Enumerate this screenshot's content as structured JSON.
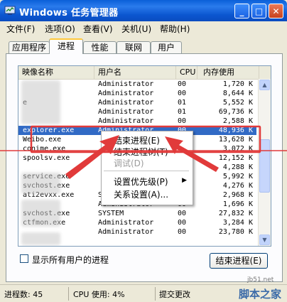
{
  "title": "Windows 任务管理器",
  "menu": [
    "文件(F)",
    "选项(O)",
    "查看(V)",
    "关机(U)",
    "帮助(H)"
  ],
  "tabs": [
    "应用程序",
    "进程",
    "性能",
    "联网",
    "用户"
  ],
  "active_tab": "进程",
  "columns": [
    "映像名称",
    "用户名",
    "CPU",
    "内存使用"
  ],
  "rows": [
    {
      "name": "",
      "user": "Administrator",
      "cpu": "00",
      "mem": "1,720 K"
    },
    {
      "name": "",
      "user": "Administrator",
      "cpu": "00",
      "mem": "8,644 K"
    },
    {
      "name": "e",
      "user": "Administrator",
      "cpu": "01",
      "mem": "5,552 K"
    },
    {
      "name": "",
      "user": "Administrator",
      "cpu": "01",
      "mem": "69,736 K"
    },
    {
      "name": "",
      "user": "Administrator",
      "cpu": "00",
      "mem": "2,588 K"
    },
    {
      "name": "explorer.exe",
      "user": "Administrator",
      "cpu": "00",
      "mem": "48,936 K",
      "selected": true
    },
    {
      "name": "Weibo.exe",
      "user": "",
      "cpu": "",
      "mem": "13,628 K"
    },
    {
      "name": "conime.exe",
      "user": "",
      "cpu": "",
      "mem": "3,072 K"
    },
    {
      "name": "spoolsv.exe",
      "user": "",
      "cpu": "",
      "mem": "12,152 K"
    },
    {
      "name": "",
      "user": "",
      "cpu": "",
      "mem": "4,288 K"
    },
    {
      "name": "service.exe",
      "user": "",
      "cpu": "",
      "mem": "5,992 K"
    },
    {
      "name": "svchost.exe",
      "user": "",
      "cpu": "",
      "mem": "4,276 K"
    },
    {
      "name": "ati2evxx.exe",
      "user": "SYSTEM",
      "cpu": "00",
      "mem": "2,968 K"
    },
    {
      "name": "",
      "user": "Administrator",
      "cpu": "00",
      "mem": "1,696 K"
    },
    {
      "name": "svchost.exe",
      "user": "SYSTEM",
      "cpu": "00",
      "mem": "27,832 K"
    },
    {
      "name": "ctfmon.exe",
      "user": "Administrator",
      "cpu": "00",
      "mem": "3,284 K"
    },
    {
      "name": "",
      "user": "Administrator",
      "cpu": "00",
      "mem": "23,780 K"
    }
  ],
  "context_menu": {
    "end_process": "结束进程(E)",
    "end_tree": "结束进程树(T)",
    "debug": "调试(D)",
    "set_priority": "设置优先级(P)",
    "set_affinity": "关系设置(A)..."
  },
  "show_all_users_label": "显示所有用户的进程",
  "end_process_button": "结束进程(E)",
  "status": {
    "processes": "进程数: 45",
    "cpu": "CPU 使用: 4%",
    "commit": "提交更改"
  },
  "watermark": {
    "site": "jb51.net",
    "name": "脚本之家"
  }
}
